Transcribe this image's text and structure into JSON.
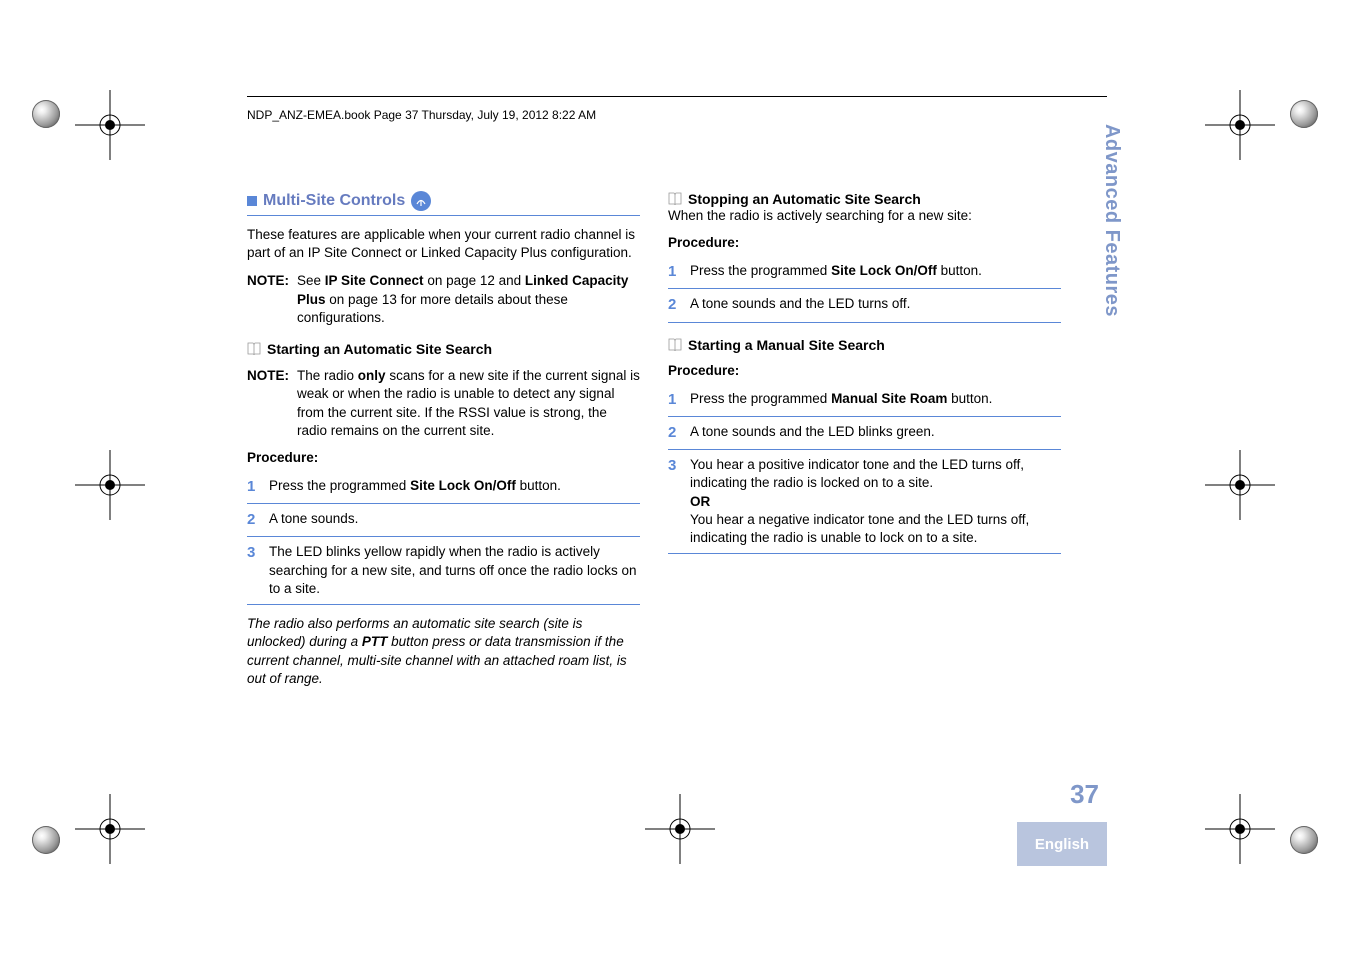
{
  "header_line": "NDP_ANZ-EMEA.book  Page 37  Thursday, July 19, 2012  8:22 AM",
  "section_title": "Multi-Site Controls",
  "intro": "These features are applicable when your current radio channel is part of an IP Site Connect or Linked Capacity Plus configuration.",
  "note_label": "NOTE:",
  "note1_pre": "See ",
  "note1_b1": "IP Site Connect",
  "note1_mid1": " on page 12 and ",
  "note1_b2": "Linked Capacity Plus",
  "note1_post": " on page 13 for more details about these configurations.",
  "sub1": "Starting an Automatic Site Search",
  "note2_pre": "The radio ",
  "note2_b": "only",
  "note2_post": " scans for a new site if the current signal is weak or when the radio is unable to detect any signal from the current site. If the RSSI value is strong, the radio remains on the current site.",
  "proc_label": "Procedure:",
  "s1n": "1",
  "s1_pre": "Press the programmed ",
  "s1_b": "Site Lock On/Off",
  "s1_post": " button.",
  "s2n": "2",
  "s2_t": "A tone sounds.",
  "s3n": "3",
  "s3_t": "The LED blinks yellow rapidly when the radio is actively searching for a new site, and turns off once the radio locks on to a site.",
  "footnote_pre": "The radio also performs an automatic site search (site is unlocked) during a ",
  "footnote_b": "PTT",
  "footnote_post": " button press or data transmission if the current channel, multi-site channel with an attached roam list, is out of range.",
  "sub2": "Stopping an Automatic Site Search",
  "when_text": "When the radio is actively searching for a new site:",
  "r1n": "1",
  "r1_pre": "Press the programmed ",
  "r1_b": "Site Lock On/Off",
  "r1_post": " button.",
  "r2n": "2",
  "r2_t": "A tone sounds and the LED turns off.",
  "sub3": "Starting a Manual Site Search",
  "m1n": "1",
  "m1_pre": "Press the programmed ",
  "m1_b": "Manual Site Roam",
  "m1_post": " button.",
  "m2n": "2",
  "m2_t": "A tone sounds and the LED blinks green.",
  "m3n": "3",
  "m3_l1": "You hear a positive indicator tone and the LED turns off, indicating the radio is locked on to a site.",
  "m3_or": "OR",
  "m3_l2": "You hear a negative indicator tone and the LED turns off, indicating the radio is unable to lock on to a site.",
  "side_tab": "Advanced Features",
  "page_num": "37",
  "language": "English"
}
